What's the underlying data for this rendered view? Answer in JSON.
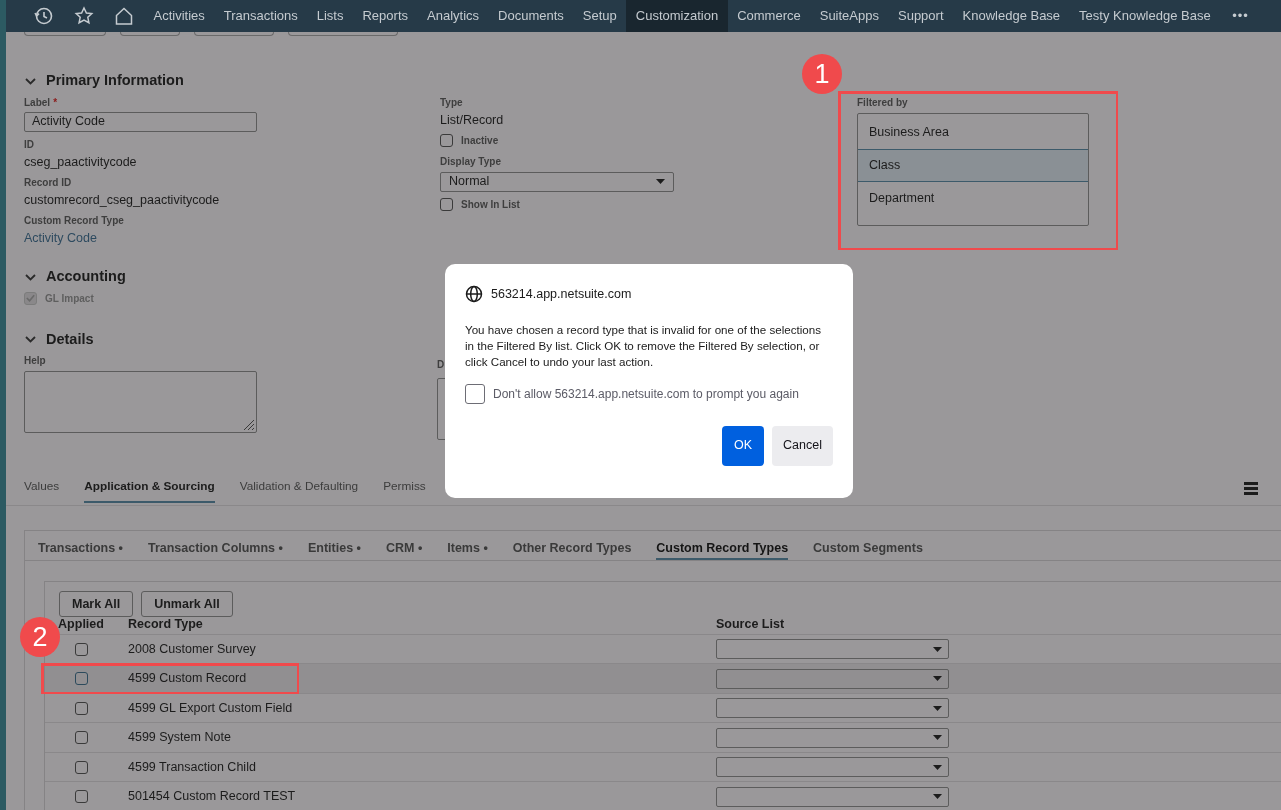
{
  "nav": {
    "items": [
      {
        "label": "Activities",
        "selected": false
      },
      {
        "label": "Transactions",
        "selected": false
      },
      {
        "label": "Lists",
        "selected": false
      },
      {
        "label": "Reports",
        "selected": false
      },
      {
        "label": "Analytics",
        "selected": false
      },
      {
        "label": "Documents",
        "selected": false
      },
      {
        "label": "Setup",
        "selected": false
      },
      {
        "label": "Customization",
        "selected": true
      },
      {
        "label": "Commerce",
        "selected": false
      },
      {
        "label": "SuiteApps",
        "selected": false
      },
      {
        "label": "Support",
        "selected": false
      },
      {
        "label": "Knowledge Base",
        "selected": false
      },
      {
        "label": "Testy Knowledge Base",
        "selected": false
      }
    ],
    "more": "•••"
  },
  "primary_information": {
    "title": "Primary Information",
    "expanded": true,
    "label_field": {
      "label": "Label",
      "required": "*",
      "value": "Activity Code"
    },
    "id": {
      "label": "ID",
      "value": "cseg_paactivitycode"
    },
    "record_id": {
      "label": "Record ID",
      "value": "customrecord_cseg_paactivitycode"
    },
    "custom_record_type": {
      "label": "Custom Record Type",
      "value": "Activity Code"
    },
    "type": {
      "label": "Type",
      "value": "List/Record"
    },
    "inactive": {
      "label": "Inactive",
      "checked": false
    },
    "display_type": {
      "label": "Display Type",
      "value": "Normal"
    },
    "show_in_list": {
      "label": "Show In List",
      "checked": false
    },
    "filtered_by": {
      "label": "Filtered by",
      "items": [
        {
          "label": "Business Area",
          "selected": false
        },
        {
          "label": "Class",
          "selected": true
        },
        {
          "label": "Department",
          "selected": false
        }
      ]
    }
  },
  "accounting": {
    "title": "Accounting",
    "expanded": true,
    "gl_impact": {
      "label": "GL Impact",
      "checked": true,
      "disabled": true
    }
  },
  "details": {
    "title": "Details",
    "expanded": true,
    "help": {
      "label": "Help"
    },
    "column_2_label": "D"
  },
  "tabs": [
    {
      "label": "Values",
      "selected": false
    },
    {
      "label": "Application & Sourcing",
      "selected": true
    },
    {
      "label": "Validation & Defaulting",
      "selected": false
    },
    {
      "label": "Permiss",
      "selected": false
    }
  ],
  "subtabs": [
    {
      "label": "Transactions •",
      "selected": false
    },
    {
      "label": "Transaction Columns •",
      "selected": false
    },
    {
      "label": "Entities •",
      "selected": false
    },
    {
      "label": "CRM •",
      "selected": false
    },
    {
      "label": "Items •",
      "selected": false
    },
    {
      "label": "Other Record Types",
      "selected": false
    },
    {
      "label": "Custom Record Types",
      "selected": true
    },
    {
      "label": "Custom Segments",
      "selected": false
    }
  ],
  "list_buttons": [
    "Mark All",
    "Unmark All"
  ],
  "table": {
    "columns": [
      "Applied",
      "Record Type",
      "Source List"
    ],
    "rows": [
      {
        "applied": false,
        "record_type": "2008 Customer Survey",
        "selected": false
      },
      {
        "applied": false,
        "record_type": "4599 Custom Record",
        "selected": true
      },
      {
        "applied": false,
        "record_type": "4599 GL Export Custom Field",
        "selected": false
      },
      {
        "applied": false,
        "record_type": "4599 System Note",
        "selected": false
      },
      {
        "applied": false,
        "record_type": "4599 Transaction Child",
        "selected": false
      },
      {
        "applied": false,
        "record_type": "501454 Custom Record TEST",
        "selected": false
      }
    ]
  },
  "dialog": {
    "origin": "563214.app.netsuite.com",
    "message": "You have chosen a record type that is invalid for one of the selections in the Filtered By list. Click OK to remove the Filtered By selection, or click Cancel to undo your last action.",
    "dont_allow": {
      "label": "Don't allow 563214.app.netsuite.com to prompt you again",
      "checked": false
    },
    "buttons": [
      {
        "label": "OK",
        "kind": "primary"
      },
      {
        "label": "Cancel",
        "kind": "secondary"
      }
    ]
  },
  "annotations": [
    {
      "label": "1"
    },
    {
      "label": "2"
    }
  ]
}
